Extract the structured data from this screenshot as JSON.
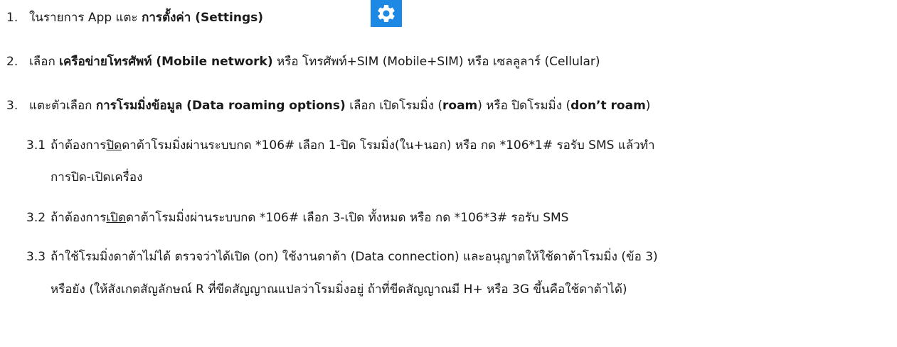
{
  "steps": [
    {
      "num": "1.",
      "parts": [
        {
          "t": "ในรายการ App แตะ ",
          "b": false
        },
        {
          "t": "การตั้งค่า (Settings)",
          "b": true
        }
      ],
      "icon": "settings-gear-icon"
    },
    {
      "num": "2.",
      "parts": [
        {
          "t": "เลือก ",
          "b": false
        },
        {
          "t": "เครือข่ายโทรศัพท์ (Mobile network)",
          "b": true
        },
        {
          "t": " หรือ โทรศัพท์+SIM (Mobile+SIM) หรือ เซลลูลาร์ (Cellular)",
          "b": false
        }
      ]
    },
    {
      "num": "3.",
      "parts": [
        {
          "t": "แตะตัวเลือก ",
          "b": false
        },
        {
          "t": "การโรมมิ่งข้อมูล (Data roaming options)",
          "b": true
        },
        {
          "t": " เลือก เปิดโรมมิ่ง (",
          "b": false
        },
        {
          "t": "roam",
          "b": true
        },
        {
          "t": ") หรือ ปิดโรมมิ่ง (",
          "b": false
        },
        {
          "t": "don’t roam",
          "b": true
        },
        {
          "t": ")",
          "b": false
        }
      ]
    }
  ],
  "substeps": [
    {
      "num": "3.1",
      "lines": [
        [
          {
            "t": "ถ้าต้องการ",
            "u": false
          },
          {
            "t": "ปิด",
            "u": true
          },
          {
            "t": "ดาต้าโรมมิ่งผ่านระบบกด *106# เลือก 1-ปิด โรมมิ่ง(ใน+นอก) หรือ กด *106*1# รอรับ SMS แล้วทำ",
            "u": false
          }
        ],
        [
          {
            "t": "การปิด-เปิดเครื่อง",
            "u": false
          }
        ]
      ]
    },
    {
      "num": "3.2",
      "lines": [
        [
          {
            "t": "ถ้าต้องการ",
            "u": false
          },
          {
            "t": "เปิด",
            "u": true
          },
          {
            "t": "ดาต้าโรมมิ่งผ่านระบบกด *106# เลือก 3-เปิด ทั้งหมด หรือ กด *106*3# รอรับ SMS",
            "u": false
          }
        ]
      ]
    },
    {
      "num": "3.3",
      "lines": [
        [
          {
            "t": "ถ้าใช้โรมมิ่งดาต้าไม่ได้ ตรวจว่าได้เปิด (on) ใช้งานดาต้า (Data connection) และอนุญาตให้ใช้ดาต้าโรมมิ่ง (ข้อ 3)",
            "u": false
          }
        ],
        [
          {
            "t": "หรือยัง (ให้สังเกตสัญลักษณ์ R ที่ขีดสัญญาณแปลว่าโรมมิ่งอยู่ ถ้าที่ขีดสัญญาณมี H+ หรือ 3G ขึ้นคือใช้ดาต้าได้)",
            "u": false
          }
        ]
      ]
    }
  ],
  "colors": {
    "icon_bg": "#1e88e5",
    "icon_fg": "#ffffff",
    "text": "#1a1a1a"
  }
}
